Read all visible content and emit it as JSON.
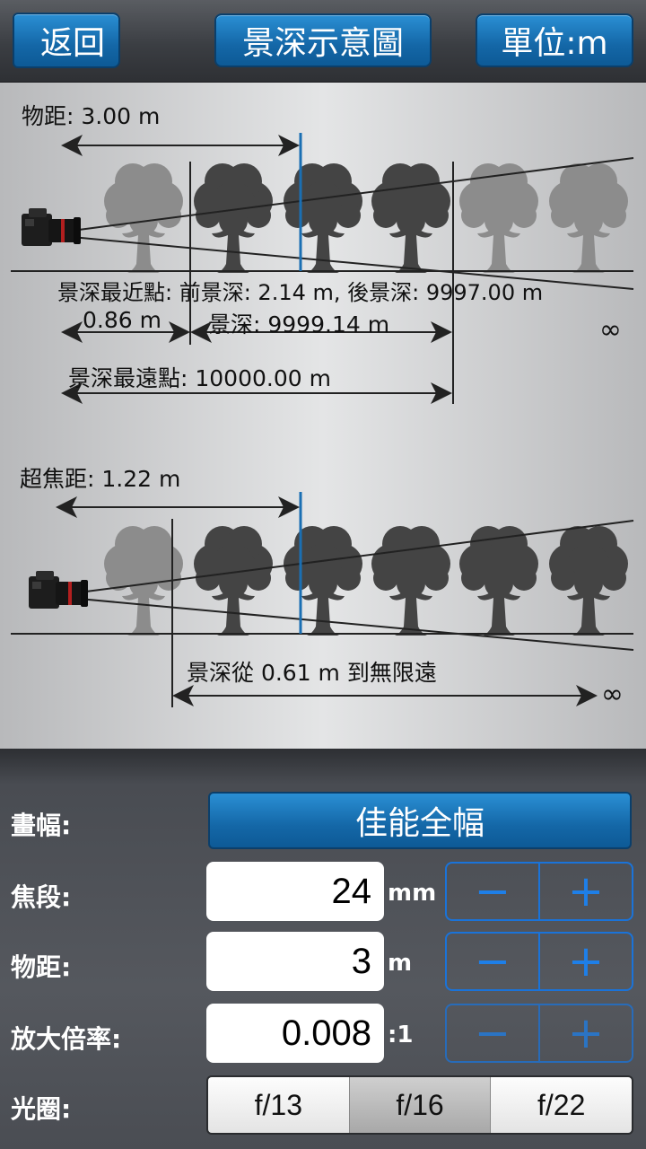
{
  "nav": {
    "back_label": "返回",
    "title": "景深示意圖",
    "unit_label": "單位:m"
  },
  "diagram1": {
    "subject_distance": "物距: 3.00 m",
    "near_far_line": "景深最近點: 前景深: 2.14 m, 後景深: 9997.00 m",
    "near_value": "0.86 m",
    "dof_total": "景深: 9999.14 m",
    "infinity": "∞",
    "far_point": "景深最遠點: 10000.00 m"
  },
  "diagram2": {
    "hyperfocal": "超焦距: 1.22 m",
    "dof_range": "景深從 0.61 m 到無限遠",
    "infinity": "∞"
  },
  "controls": {
    "format_label": "畫幅:",
    "format_value": "佳能全幅",
    "focal_label": "焦段:",
    "focal_value": "24",
    "focal_unit": "mm",
    "distance_label": "物距:",
    "distance_value": "3",
    "distance_unit": "m",
    "magnification_label": "放大倍率:",
    "magnification_value": "0.008",
    "magnification_unit": ":1",
    "minus": "−",
    "plus": "+",
    "aperture_label": "光圈:",
    "apertures": [
      "f/13",
      "f/16",
      "f/22"
    ],
    "selected_aperture": "f/16"
  },
  "colors": {
    "accent": "#1a73d9",
    "nav_button": "#1467a7",
    "focus_line": "#1a6fb3",
    "tree_dark": "#444444",
    "tree_light": "#8c8c8c"
  },
  "icons": {
    "camera": "camera-icon",
    "tree": "tree-icon"
  }
}
